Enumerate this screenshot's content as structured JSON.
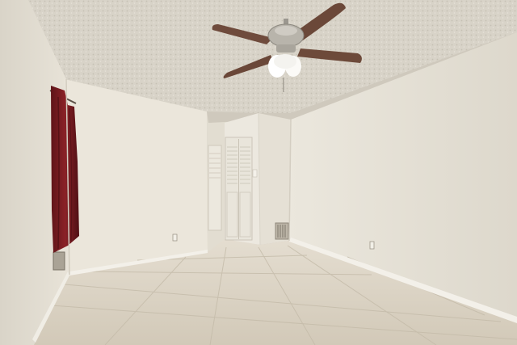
{
  "scene": {
    "description_type": "photo",
    "palette": {
      "ceiling": "#d8d3c8",
      "wall_left": "#e6e1d6",
      "wall_back": "#ebe7dc",
      "wall_right": "#e3ded3",
      "floor": "#d9d1c3",
      "floor_grout": "#c8bfae",
      "curtain": "#7a1d22",
      "fan_blade": "#6b4a3b",
      "fan_metal": "#b9b5ad",
      "door": "#e8e4da",
      "baseboard": "#f2efe8"
    }
  }
}
